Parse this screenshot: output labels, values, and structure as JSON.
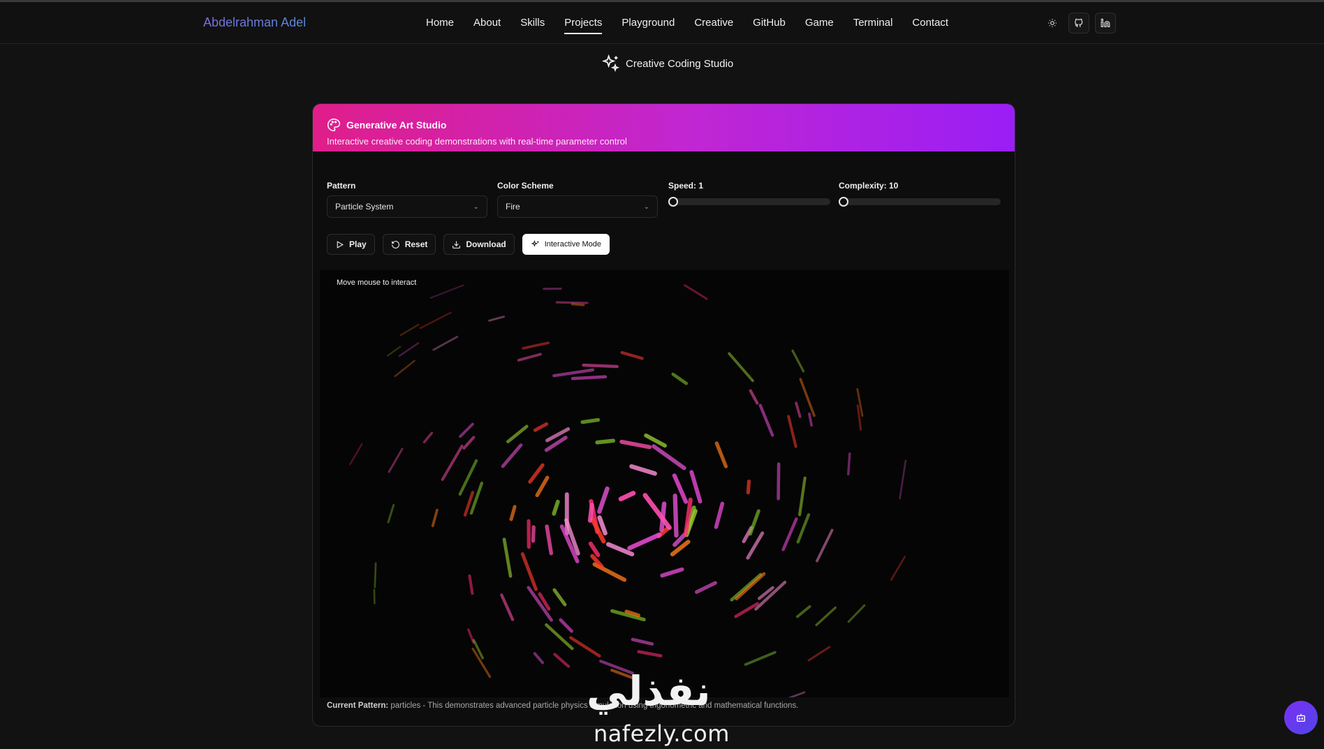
{
  "brand": "Abdelrahman Adel",
  "nav": {
    "links": [
      "Home",
      "About",
      "Skills",
      "Projects",
      "Playground",
      "Creative",
      "GitHub",
      "Game",
      "Terminal",
      "Contact"
    ],
    "active": "Projects",
    "icons": [
      "sun-icon",
      "github-icon",
      "linkedin-icon"
    ]
  },
  "section_title": "Creative Coding Studio",
  "studio": {
    "title": "Generative Art Studio",
    "subtitle": "Interactive creative coding demonstrations with real-time parameter control",
    "accent_from": "#e01e8a",
    "accent_to": "#9a1ef5",
    "pattern": {
      "label": "Pattern",
      "value": "Particle System"
    },
    "color_scheme": {
      "label": "Color Scheme",
      "value": "Fire"
    },
    "speed": {
      "label": "Speed: 1",
      "value": 1
    },
    "complexity": {
      "label": "Complexity: 10",
      "value": 10
    },
    "buttons": {
      "play": "Play",
      "reset": "Reset",
      "download": "Download",
      "interactive": "Interactive Mode"
    },
    "canvas_hint": "Move mouse to interact",
    "footnote_label": "Current Pattern:",
    "footnote_text": "particles - This demonstrates advanced particle physics simulation using trigonometric and mathematical functions."
  },
  "watermark": {
    "text": "nafezly.com",
    "arabic": "نفذلي"
  }
}
